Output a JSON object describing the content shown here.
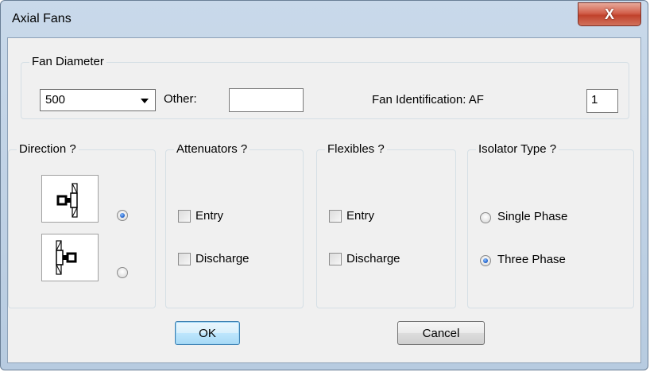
{
  "window": {
    "title": "Axial Fans",
    "close_glyph": "X"
  },
  "fan_diameter": {
    "group_title": "Fan Diameter",
    "selected": "500",
    "other_label": "Other:",
    "other_value": "",
    "fan_id_label": "Fan Identification: AF",
    "fan_id_value": "1"
  },
  "direction": {
    "group_title": "Direction ?",
    "options": [
      {
        "icon": "fan-direction-right-icon",
        "selected": true
      },
      {
        "icon": "fan-direction-left-icon",
        "selected": false
      }
    ]
  },
  "attenuators": {
    "group_title": "Attenuators ?",
    "entry_label": "Entry",
    "entry_checked": false,
    "discharge_label": "Discharge",
    "discharge_checked": false
  },
  "flexibles": {
    "group_title": "Flexibles ?",
    "entry_label": "Entry",
    "entry_checked": false,
    "discharge_label": "Discharge",
    "discharge_checked": false
  },
  "isolator": {
    "group_title": "Isolator Type ?",
    "single_label": "Single Phase",
    "three_label": "Three Phase",
    "selected": "Three Phase"
  },
  "buttons": {
    "ok_label": "OK",
    "cancel_label": "Cancel"
  }
}
